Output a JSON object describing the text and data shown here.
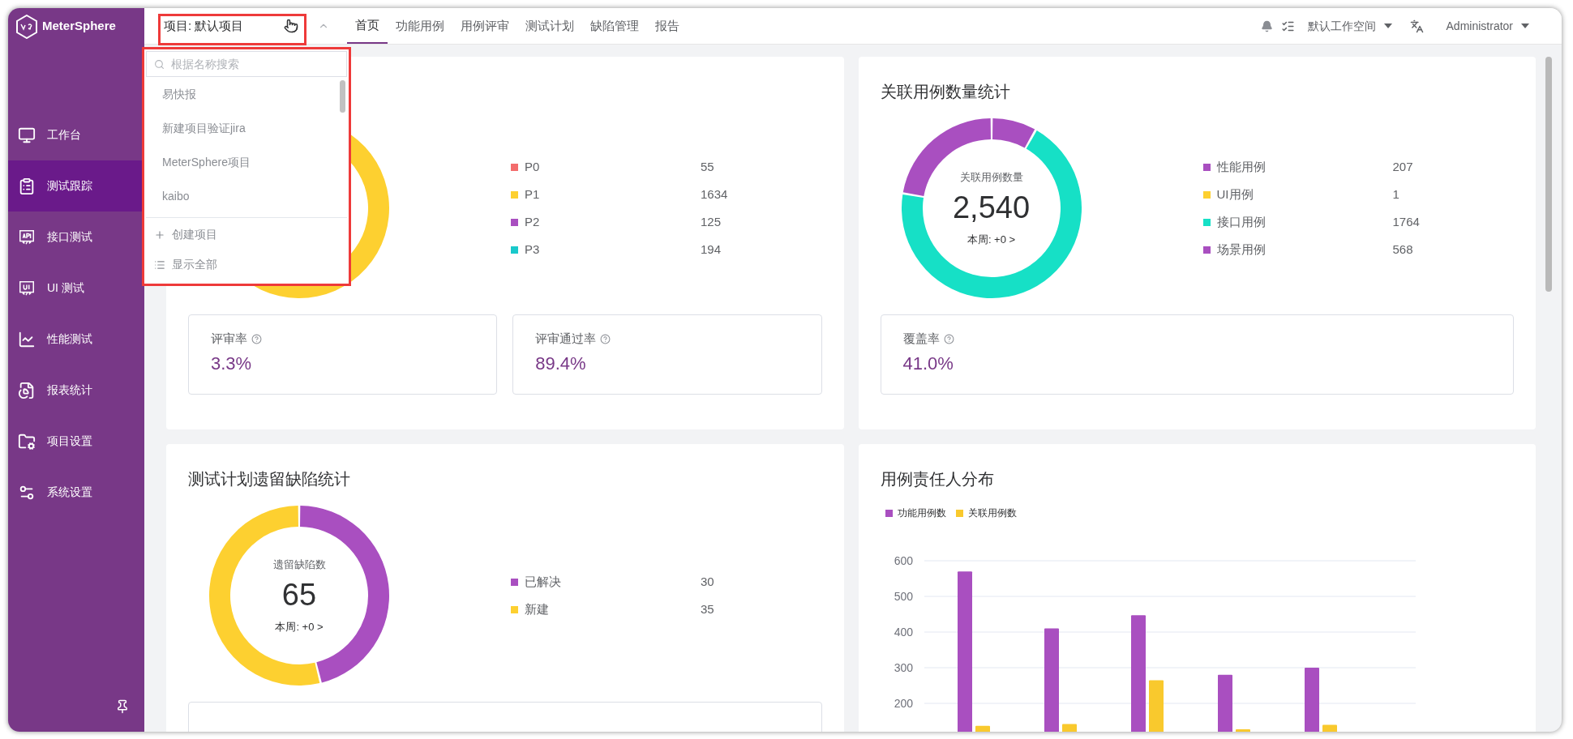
{
  "sidebar": {
    "logo": "MeterSphere",
    "items": [
      {
        "label": "工作台",
        "selected": false
      },
      {
        "label": "测试跟踪",
        "selected": true
      },
      {
        "label": "接口测试",
        "selected": false
      },
      {
        "label": "UI 测试",
        "selected": false
      },
      {
        "label": "性能测试",
        "selected": false
      },
      {
        "label": "报表统计",
        "selected": false
      },
      {
        "label": "项目设置",
        "selected": false
      },
      {
        "label": "系统设置",
        "selected": false
      }
    ]
  },
  "header": {
    "project_selector": "项目: 默认项目",
    "tabs": [
      {
        "label": "首页",
        "selected": true
      },
      {
        "label": "功能用例",
        "selected": false
      },
      {
        "label": "用例评审",
        "selected": false
      },
      {
        "label": "测试计划",
        "selected": false
      },
      {
        "label": "缺陷管理",
        "selected": false
      },
      {
        "label": "报告",
        "selected": false
      }
    ],
    "workspace": "默认工作空间",
    "user": "Administrator"
  },
  "project_dropdown": {
    "placeholder": "根据名称搜索",
    "items": [
      "易快报",
      "新建项目验证jira",
      "MeterSphere项目",
      "kaibo"
    ],
    "actions": [
      "创建项目",
      "显示全部"
    ]
  },
  "cards": [
    {
      "legend": [
        {
          "label": "P0",
          "value": "55",
          "color": "#f36c6c"
        },
        {
          "label": "P1",
          "value": "1634",
          "color": "#fdd030"
        },
        {
          "label": "P2",
          "value": "125",
          "color": "#a94fc0"
        },
        {
          "label": "P3",
          "value": "194",
          "color": "#19c9cb"
        }
      ],
      "rates": [
        {
          "label": "评审率",
          "value": "3.3%"
        },
        {
          "label": "评审通过率",
          "value": "89.4%"
        }
      ]
    },
    {
      "title": "关联用例数量统计",
      "center": {
        "label": "关联用例数量",
        "value": "2,540",
        "week": "本周: +0 >"
      },
      "legend": [
        {
          "label": "性能用例",
          "value": "207",
          "color": "#a94fc0"
        },
        {
          "label": "UI用例",
          "value": "1",
          "color": "#fdd030"
        },
        {
          "label": "接口用例",
          "value": "1764",
          "color": "#16e0c6"
        },
        {
          "label": "场景用例",
          "value": "568",
          "color": "#a94fc0"
        }
      ],
      "rates": [
        {
          "label": "覆盖率",
          "value": "41.0%"
        }
      ]
    },
    {
      "title": "测试计划遗留缺陷统计",
      "center": {
        "label": "遗留缺陷数",
        "value": "65",
        "week": "本周: +0 >"
      },
      "legend": [
        {
          "label": "已解决",
          "value": "30",
          "color": "#a94fc0"
        },
        {
          "label": "新建",
          "value": "35",
          "color": "#fdd030"
        }
      ]
    },
    {
      "title": "用例责任人分布",
      "chart_data": {
        "type": "bar",
        "ylim": [
          100,
          600
        ],
        "yticks": [
          200,
          300,
          400,
          500,
          600
        ],
        "grid": true,
        "series": [
          {
            "name": "功能用例数",
            "color": "#a94fc0",
            "values": [
              570,
              410,
              447,
              280,
              300
            ]
          },
          {
            "name": "关联用例数",
            "color": "#f9c92d",
            "values": [
              137,
              142,
              265,
              127,
              140
            ]
          }
        ]
      }
    }
  ]
}
